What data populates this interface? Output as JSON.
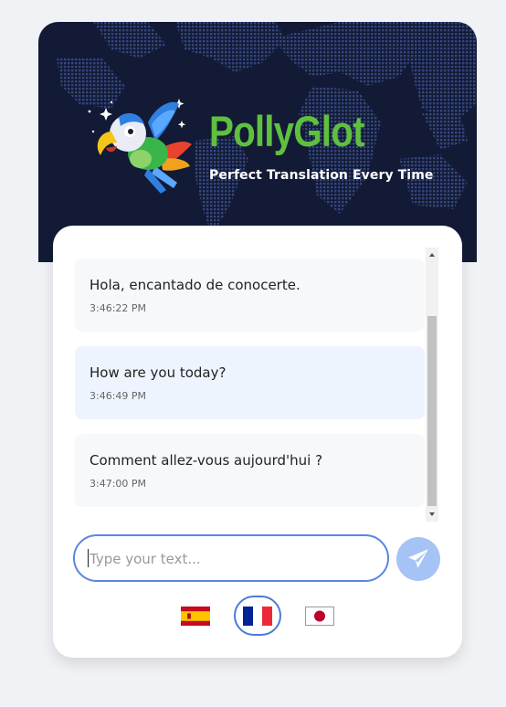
{
  "brand": {
    "title": "PollyGlot",
    "tagline": "Perfect Translation Every Time"
  },
  "messages": [
    {
      "kind": "incoming",
      "text": "Hola, encantado de conocerte.",
      "time": "3:46:22 PM"
    },
    {
      "kind": "outgoing",
      "text": "How are you today?",
      "time": "3:46:49 PM"
    },
    {
      "kind": "incoming",
      "text": "Comment allez-vous aujourd'hui ?",
      "time": "3:47:00 PM"
    }
  ],
  "composer": {
    "placeholder": "Type your text...",
    "value": ""
  },
  "languages": [
    {
      "name": "spanish",
      "icon": "spain-flag-icon",
      "selected": false
    },
    {
      "name": "french",
      "icon": "france-flag-icon",
      "selected": true
    },
    {
      "name": "japanese",
      "icon": "japan-flag-icon",
      "selected": false
    }
  ],
  "colors": {
    "banner_bg": "#121a35",
    "brand_green": "#5fc03f",
    "accent_blue": "#5b85e0",
    "send_button": "#a6c3f5",
    "incoming_bubble": "#f7f8fa",
    "outgoing_bubble": "#eef4fe"
  }
}
